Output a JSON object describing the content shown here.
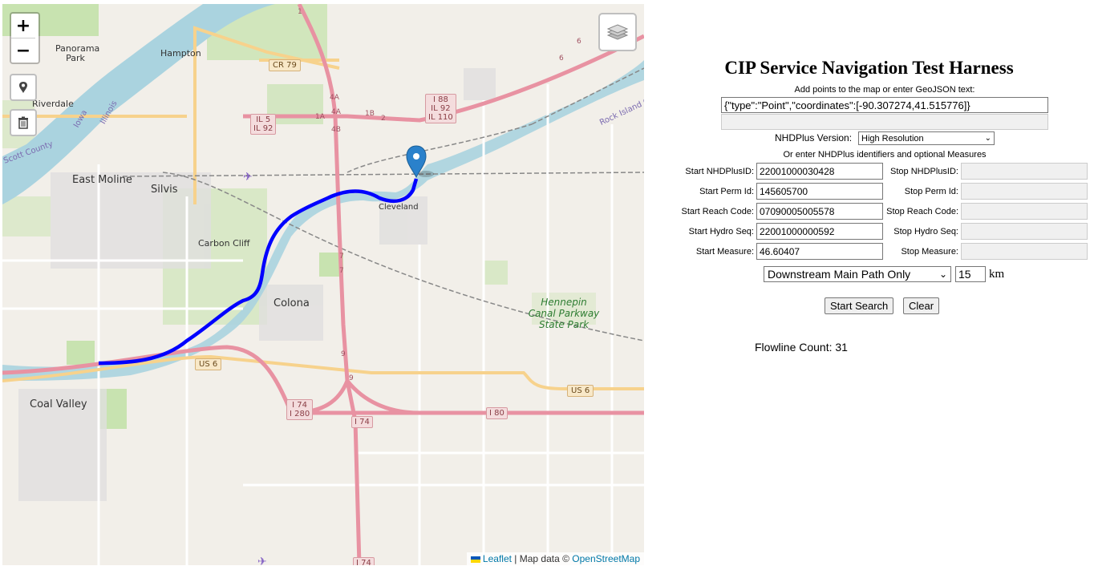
{
  "map": {
    "place_labels": {
      "panorama_park": "Panorama Park",
      "hampton": "Hampton",
      "riverdale": "Riverdale",
      "east_moline": "East Moline",
      "silvis": "Silvis",
      "cleveland": "Cleveland",
      "carbon_cliff": "Carbon Cliff",
      "colona": "Colona",
      "coal_valley": "Coal Valley",
      "hennepin": "Hennepin Canal Parkway State Park",
      "scott_county": "Scott County",
      "iowa": "Iowa",
      "illinois": "Illinois",
      "rock_island": "Rock Island Co"
    },
    "shields": {
      "cr79": "CR 79",
      "i88": "I 88\nIL 92\nIL 110",
      "il5": "IL 5\nIL 92",
      "us6_a": "US 6",
      "us6_b": "US 6",
      "i74_i280": "I 74\nI 280",
      "i74": "I 74",
      "i80": "I 80",
      "i74_bottom": "I 74"
    },
    "exit_labels": [
      "4A",
      "4A",
      "4B",
      "1A",
      "1B",
      "2",
      "7",
      "7",
      "9",
      "9",
      "1",
      "6",
      "6"
    ],
    "controls": {
      "zoom_in": "+",
      "zoom_out": "−"
    },
    "attribution": {
      "leaflet": "Leaflet",
      "sep": " | Map data © ",
      "osm": "OpenStreetMap"
    },
    "colors": {
      "flowline": "#0000ff",
      "river": "#aad3df",
      "land": "#f2efe9",
      "motorway": "#e892a2",
      "park": "#c8e3b0",
      "marker": "#2a81cb"
    }
  },
  "panel": {
    "title": "CIP Service Navigation Test Harness",
    "geojson_label": "Add points to the map or enter GeoJSON text:",
    "geojson_value": "{\"type\":\"Point\",\"coordinates\":[-90.307274,41.515776]}",
    "geojson_value2": "",
    "nhdplus_version_label": "NHDPlus Version:",
    "nhdplus_version_value": "High Resolution",
    "identifiers_label": "Or enter NHDPlus identifiers and optional Measures",
    "start": {
      "nhdplusid_label": "Start NHDPlusID:",
      "nhdplusid": "22001000030428",
      "permid_label": "Start Perm Id:",
      "permid": "145605700",
      "reachcode_label": "Start Reach Code:",
      "reachcode": "07090005005578",
      "hydroseq_label": "Start Hydro Seq:",
      "hydroseq": "22001000000592",
      "measure_label": "Start Measure:",
      "measure": "46.60407"
    },
    "stop": {
      "nhdplusid_label": "Stop NHDPlusID:",
      "permid_label": "Stop Perm Id:",
      "reachcode_label": "Stop Reach Code:",
      "hydroseq_label": "Stop Hydro Seq:",
      "measure_label": "Stop Measure:"
    },
    "navigation_type": "Downstream Main Path Only",
    "distance": "15",
    "distance_unit": "km",
    "start_search": "Start Search",
    "clear": "Clear",
    "flowline_count_label": "Flowline Count:",
    "flowline_count": "31"
  }
}
